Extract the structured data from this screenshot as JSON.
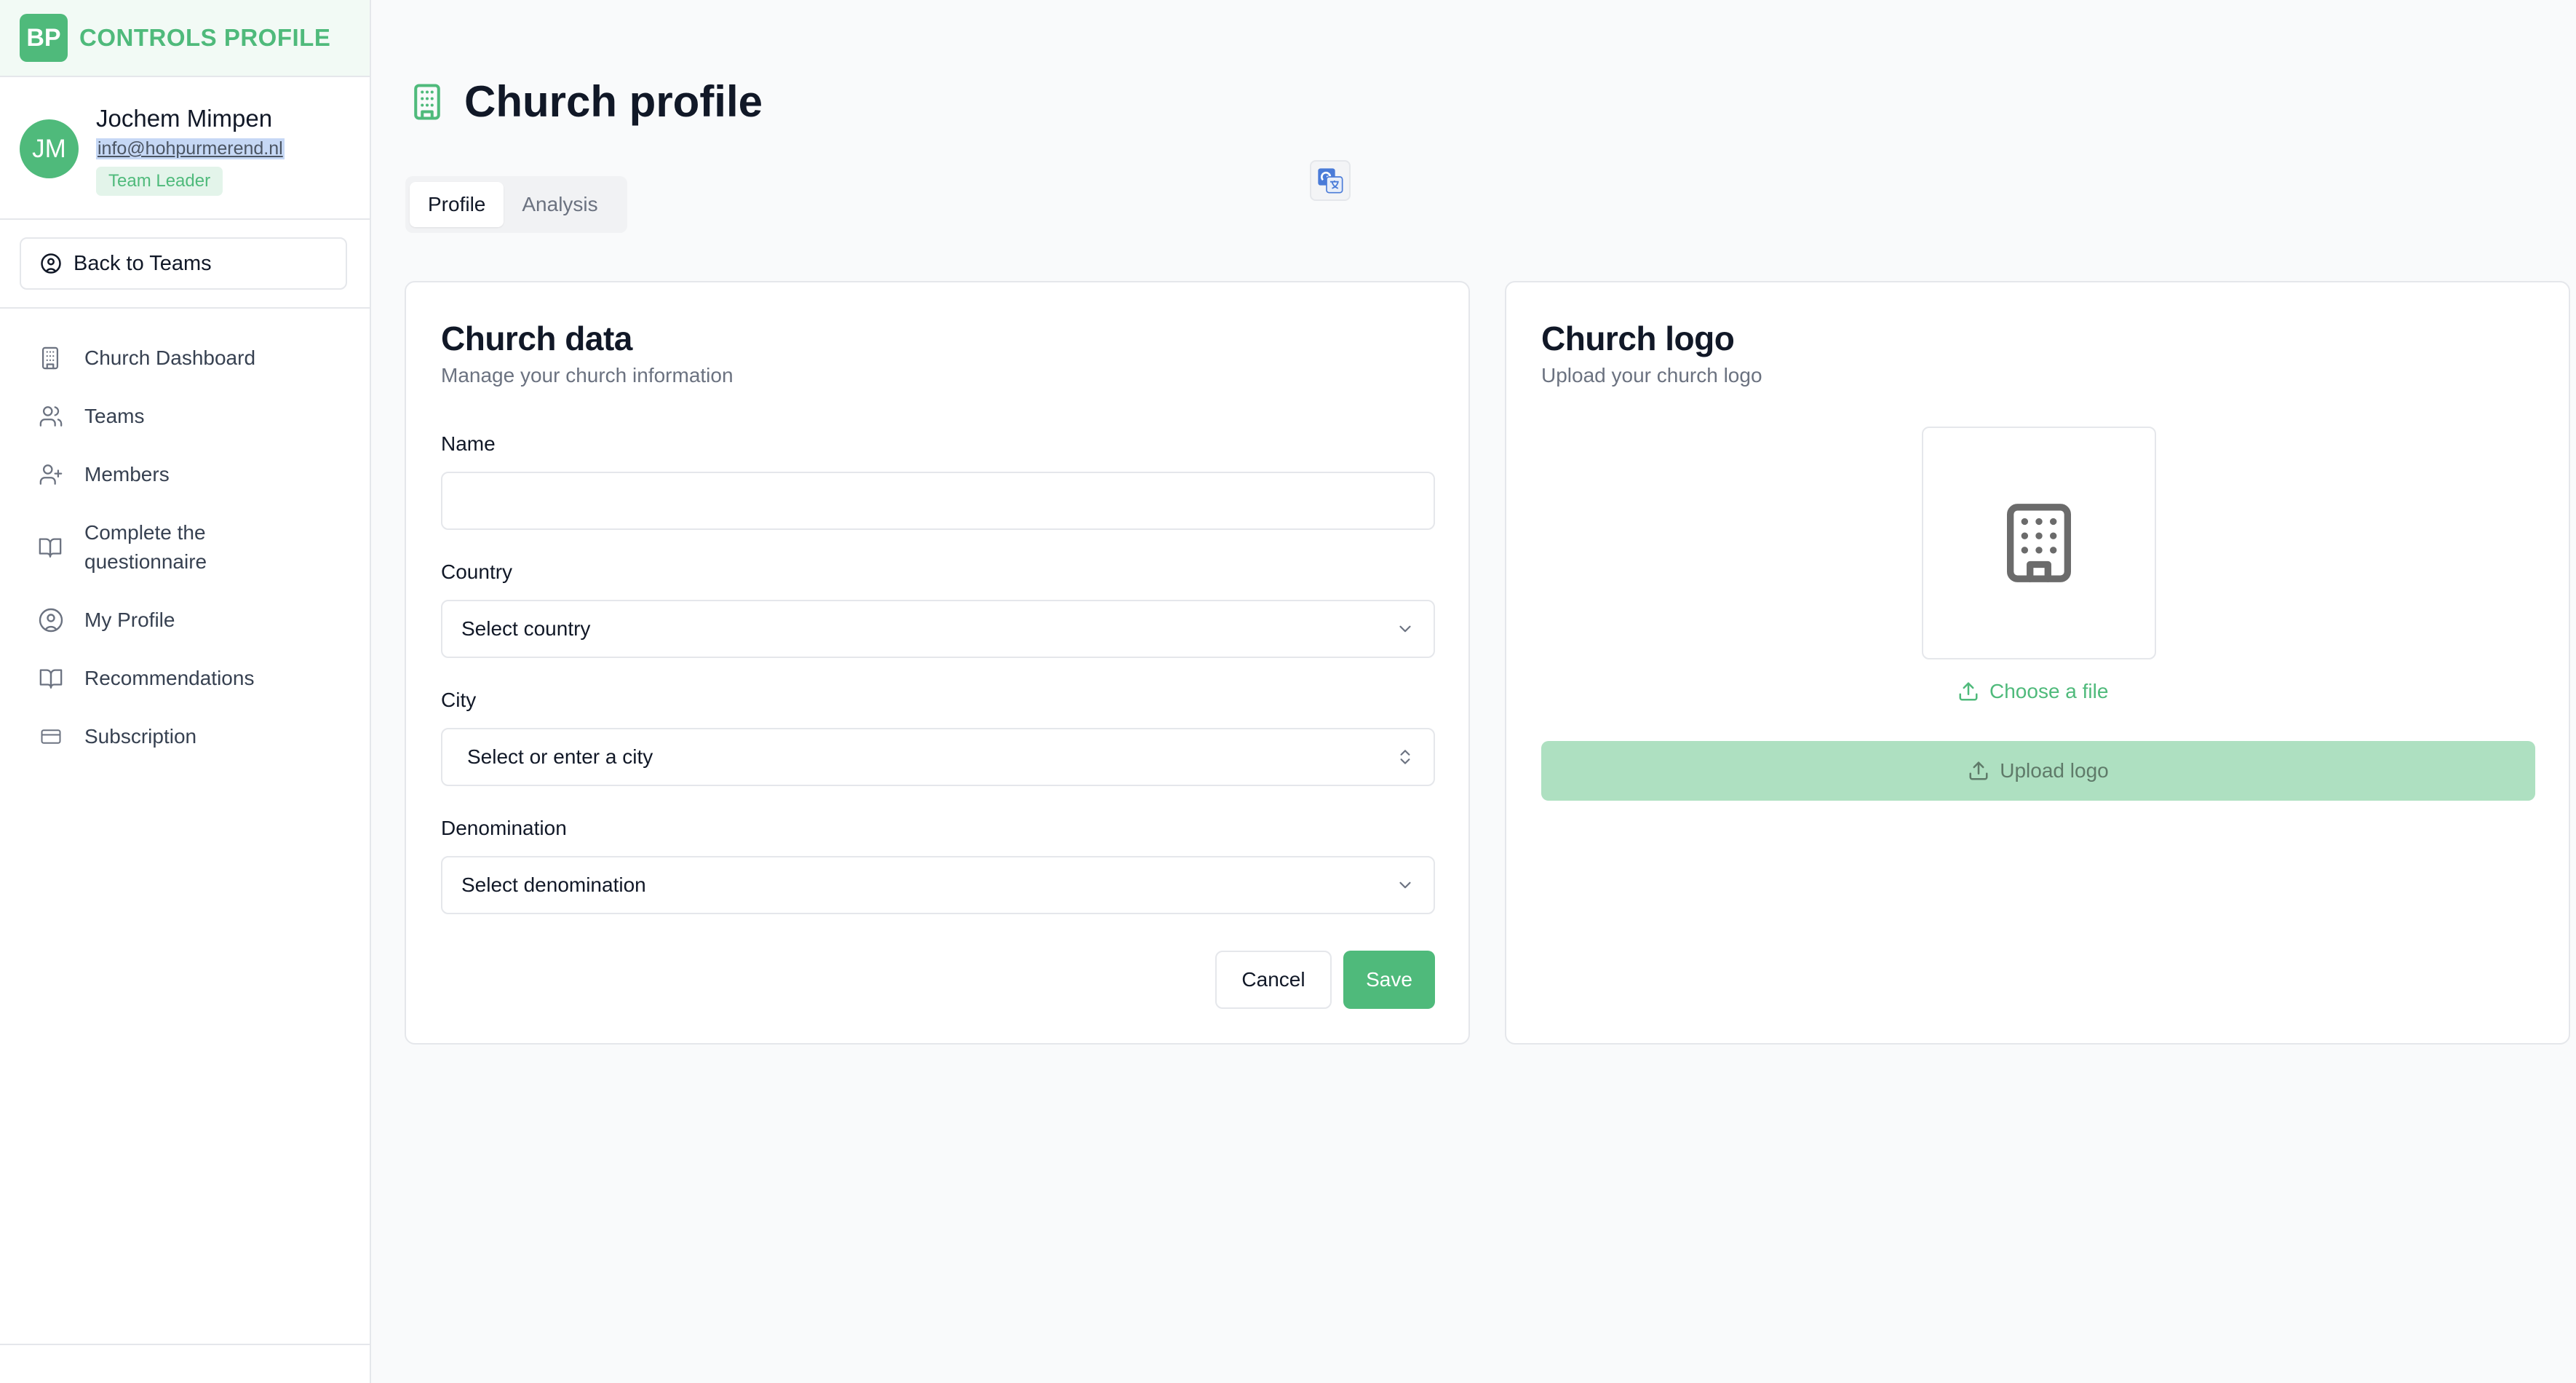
{
  "brand": {
    "logo_text": "BP",
    "title": "CONTROLS PROFILE",
    "accent": "#4fba7b"
  },
  "user": {
    "initials": "JM",
    "name": "Jochem Mimpen",
    "email": "info@hohpurmerend.nl",
    "role": "Team Leader"
  },
  "sidebar": {
    "back_label": "Back to Teams",
    "items": [
      {
        "label": "Church Dashboard",
        "icon": "building-icon"
      },
      {
        "label": "Teams",
        "icon": "users-icon"
      },
      {
        "label": "Members",
        "icon": "user-plus-icon"
      },
      {
        "label": "Complete the questionnaire",
        "icon": "book-open-icon"
      },
      {
        "label": "My Profile",
        "icon": "user-circle-icon"
      },
      {
        "label": "Recommendations",
        "icon": "book-open-icon"
      },
      {
        "label": "Subscription",
        "icon": "credit-card-icon"
      }
    ]
  },
  "page": {
    "title": "Church profile",
    "tabs": [
      {
        "label": "Profile",
        "active": true
      },
      {
        "label": "Analysis",
        "active": false
      }
    ]
  },
  "church_data": {
    "title": "Church data",
    "subtitle": "Manage your church information",
    "name_label": "Name",
    "name_value": "",
    "country_label": "Country",
    "country_placeholder": "Select country",
    "city_label": "City",
    "city_placeholder": "Select or enter a city",
    "denomination_label": "Denomination",
    "denomination_placeholder": "Select denomination",
    "cancel_label": "Cancel",
    "save_label": "Save"
  },
  "church_logo": {
    "title": "Church logo",
    "subtitle": "Upload your church logo",
    "choose_file_label": "Choose a file",
    "upload_label": "Upload logo"
  }
}
